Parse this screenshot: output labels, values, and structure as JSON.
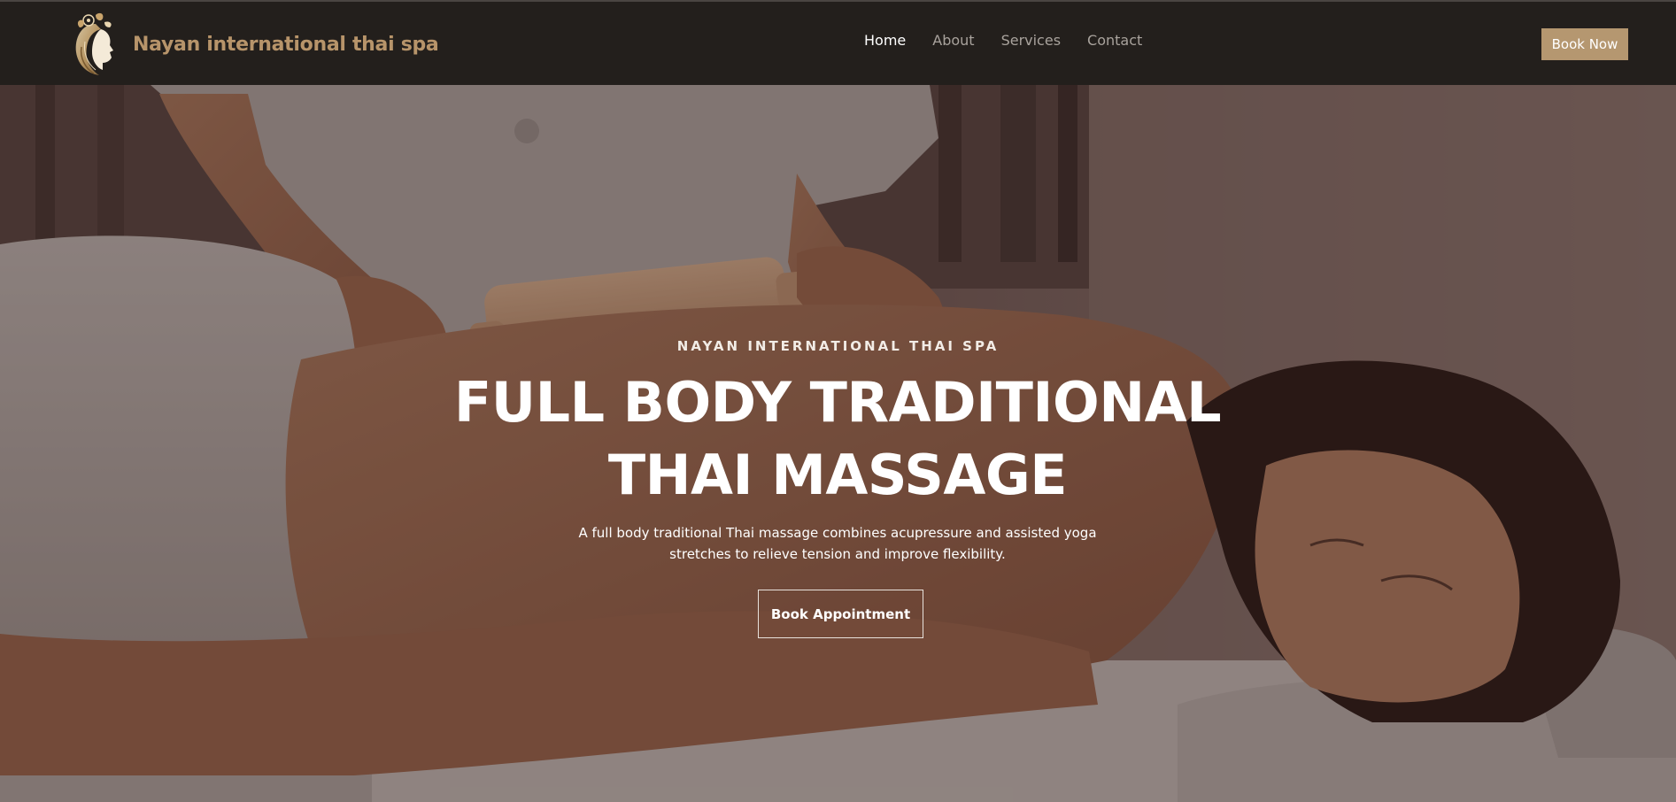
{
  "brand": {
    "name": "Nayan international thai spa",
    "logo_icon": "woman-face-flower-logo",
    "color": "#b7946a"
  },
  "nav": {
    "items": [
      {
        "label": "Home",
        "active": true
      },
      {
        "label": "About",
        "active": false
      },
      {
        "label": "Services",
        "active": false
      },
      {
        "label": "Contact",
        "active": false
      }
    ],
    "book_now_label": "Book Now"
  },
  "hero": {
    "eyebrow": "NAYAN INTERNATIONAL THAI SPA",
    "headline_line1": "FULL BODY TRADITIONAL",
    "headline_line2": "THAI MASSAGE",
    "subtext_line1": "A full body traditional Thai massage combines acupressure and assisted yoga",
    "subtext_line2": "stretches to relieve tension and improve flexibility.",
    "cta_label": "Book Appointment",
    "background_image": "woman-receiving-massage-with-wooden-roller-photo"
  },
  "colors": {
    "navbar_bg": "#231f1c",
    "accent": "#b59770",
    "nav_inactive": "#a8a29c",
    "nav_active": "#ffffff"
  }
}
